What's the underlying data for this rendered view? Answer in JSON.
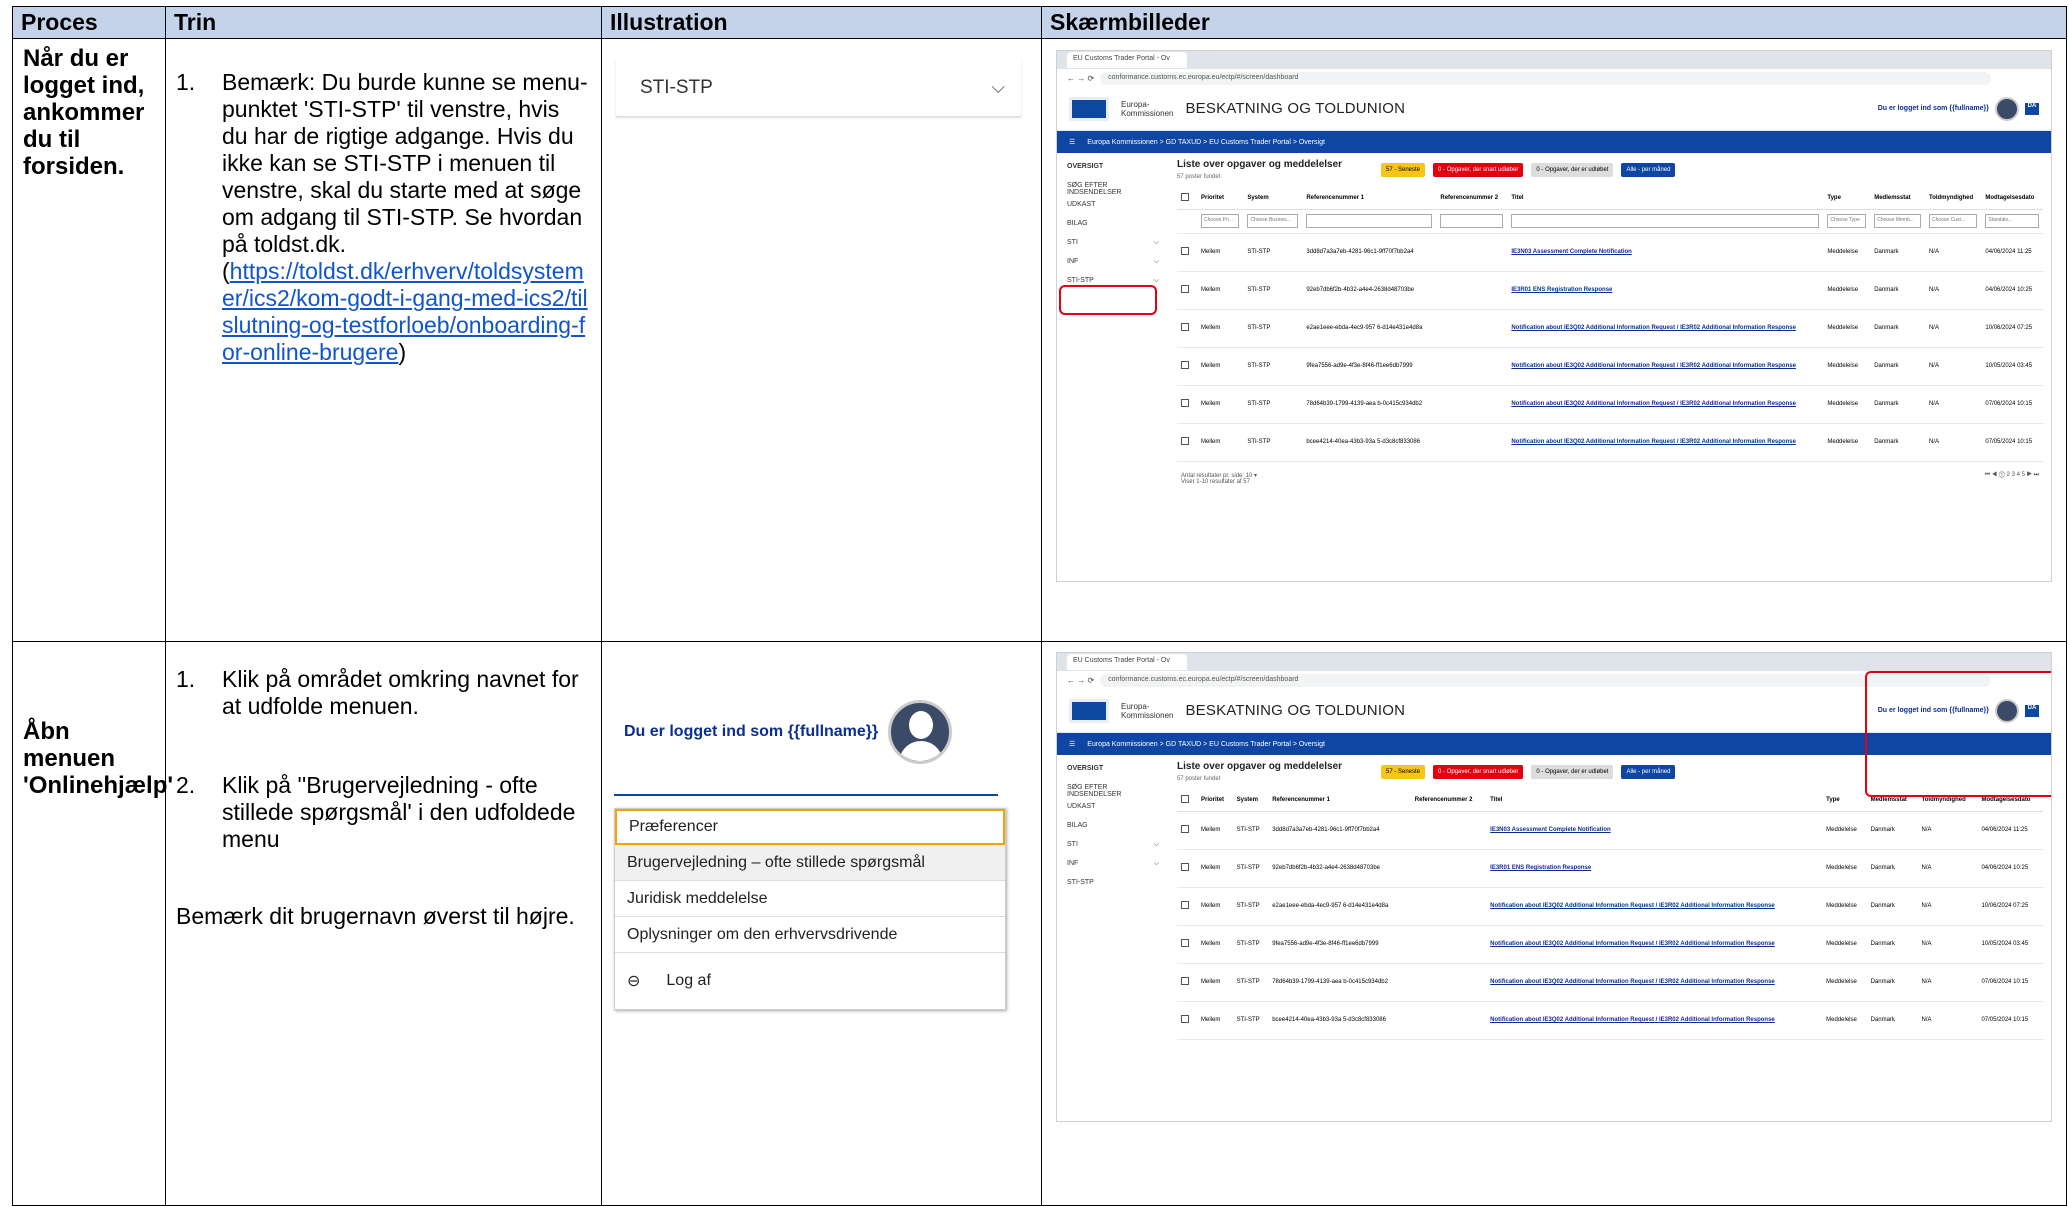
{
  "headers": {
    "proces": "Proces",
    "trin": "Trin",
    "illustration": "Illustration",
    "skaermbilleder": "Skærmbilleder"
  },
  "row1": {
    "proces": "Når du er logget ind, ankommer du til forsiden.",
    "step_num": "1.",
    "step_text": "Bemærk: Du burde kunne se menu-punktet 'STI-STP' til venstre, hvis du har de rigtige adgange. Hvis du ikke kan se STI-STP i menuen til venstre, skal du starte med at søge om adgang til STI-STP. Se hvordan på toldst.dk.",
    "link_open": "(",
    "link_text": "https://toldst.dk/erhverv/toldsystemer/ics2/kom-godt-i-gang-med-ics2/tilslutning-og-testforloeb/onboarding-for-online-brugere",
    "link_close": ")",
    "illustration_label": "STI-STP"
  },
  "row2": {
    "proces": "Åbn menuen 'Onlinehjælp'",
    "step1_num": "1.",
    "step1_text": "Klik på området omkring navnet for at udfolde menuen.",
    "step2_num": "2.",
    "step2_text": "Klik på ''Brugervejledning - ofte stillede spørgsmål' i den udfoldede menu",
    "note": "Bemærk dit brugernavn øverst til højre.",
    "login_text": "Du er logget ind som {{fullname}}",
    "menu": [
      "Præferencer",
      "Brugervejledning – ofte stillede spørgsmål",
      "Juridisk meddelelse",
      "Oplysninger om den erhvervsdrivende"
    ],
    "logout": "Log af"
  },
  "screenshot": {
    "tab": "EU Customs Trader Portal - Ov",
    "url": "conformance.customs.ec.europa.eu/ectp/#/screen/dashboard",
    "ec": "Europa-\nKommissionen",
    "brand": "BESKATNING OG TOLDUNION",
    "login": "Du er logget ind som {{fullname}}",
    "lang": "DA",
    "breadcrumb": "Europa Kommissionen > GD TAXUD > EU Customs Trader Portal > Oversigt",
    "side": [
      "OVERSIGT",
      "SØG EFTER INDSENDELSER",
      "UDKAST",
      "BILAG",
      "STI",
      "INF",
      "STI-STP"
    ],
    "list_title": "Liste over opgaver og meddelelser",
    "list_sub": "57 poster fundet",
    "pills": [
      "57 - Seneste",
      "0 - Opgaver, der snart udløber",
      "0 - Opgaver, der er udløbet",
      "Alle - per måned"
    ],
    "columns": [
      "Prioritet",
      "System",
      "Referencenummer 1",
      "Referencenummer 2",
      "Titel",
      "Type",
      "Medlemsstat",
      "Toldmyndighed",
      "Modtagelsesdato"
    ],
    "filters": [
      "Choose Pri...",
      "Choose Busines...",
      "",
      "",
      "",
      "Choose Type",
      "Choose Memb...",
      "Choose Cust...",
      "Standalo..."
    ],
    "rows": [
      [
        "Mellem",
        "STI-STP",
        "3dd8d7a3a7eb-4281-96c1-9ff70f7bb2a4",
        "",
        "IE3N03 Assessment Complete Notification",
        "Meddelelse",
        "Danmark",
        "N/A",
        "04/06/2024 11:25"
      ],
      [
        "Mellem",
        "STI-STP",
        "92eb7db6f2b-4b32-a4e4-2638d48703be",
        "",
        "IE3R01 ENS Registration Response",
        "Meddelelse",
        "Danmark",
        "N/A",
        "04/06/2024 10:25"
      ],
      [
        "Mellem",
        "STI-STP",
        "e2ae1eee-ebda-4ec9-957 6-d14e431e4d8a",
        "",
        "Notification about IE3Q02 Additional Information Request / IE3R02 Additional Information Response",
        "Meddelelse",
        "Danmark",
        "N/A",
        "10/06/2024 07:25"
      ],
      [
        "Mellem",
        "STI-STP",
        "9fea7556-ad9e-4f3e-8f46-ff1ee6db7999",
        "",
        "Notification about IE3Q02 Additional Information Request / IE3R02 Additional Information Response",
        "Meddelelse",
        "Danmark",
        "N/A",
        "10/05/2024 03:45"
      ],
      [
        "Mellem",
        "STI-STP",
        "78d64b39-1799-4139-aea b-0c415c934db2",
        "",
        "Notification about IE3Q02 Additional Information Request / IE3R02 Additional Information Response",
        "Meddelelse",
        "Danmark",
        "N/A",
        "07/06/2024 10:15"
      ],
      [
        "Mellem",
        "STI-STP",
        "bcee4214-40ea-43b3-93a 5-d3c8cf833086",
        "",
        "Notification about IE3Q02 Additional Information Request / IE3R02 Additional Information Response",
        "Meddelelse",
        "Danmark",
        "N/A",
        "07/05/2024 10:15"
      ]
    ],
    "footer_left": "Antal resultater pr. side: 10 ▾\nViser 1-10 resultater af 57",
    "pages": "⏮ ◀ ① 2 3 4 5 ▶ ⏭"
  },
  "colors": {
    "header_bg": "#c5d3ea",
    "nav_blue": "#0f46a3",
    "highlight_red": "#e3000f",
    "link": "#1155cc"
  }
}
